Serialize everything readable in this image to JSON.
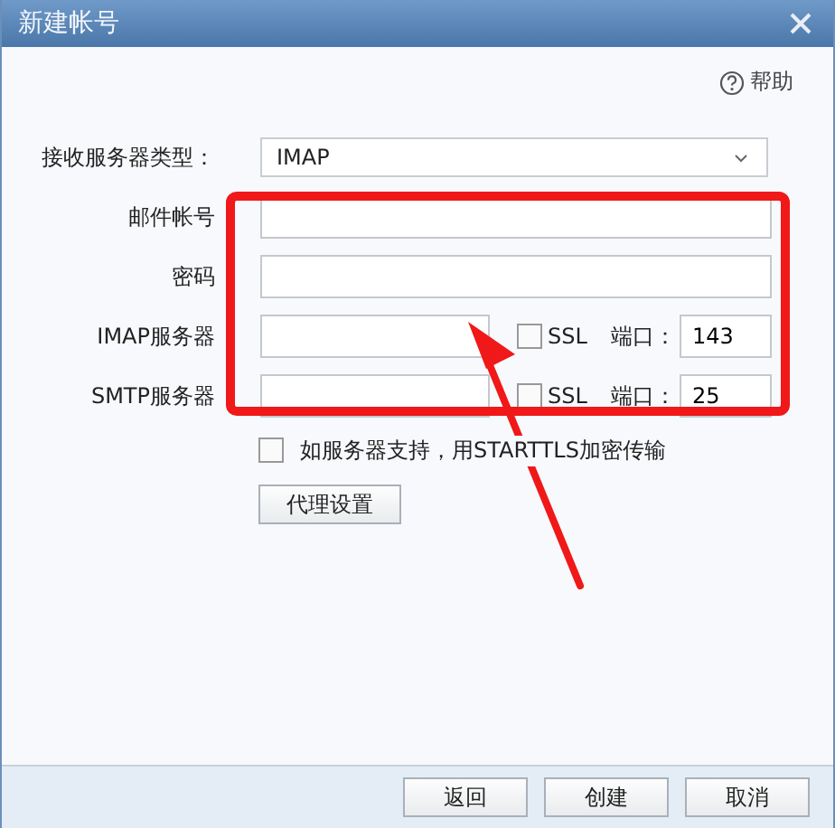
{
  "window": {
    "title": "新建帐号"
  },
  "help": {
    "label": "帮助"
  },
  "fields": [
    {
      "kind": "select",
      "label": "接收服务器类型：",
      "value": "IMAP"
    },
    {
      "kind": "text",
      "label": "邮件帐号"
    },
    {
      "kind": "text",
      "label": "密码"
    },
    {
      "kind": "server",
      "label": "IMAP服务器",
      "ssl_label": "SSL",
      "ssl_checked": false,
      "port_label": "端口：",
      "port": "143"
    },
    {
      "kind": "server",
      "label": "SMTP服务器",
      "ssl_label": "SSL",
      "ssl_checked": false,
      "port_label": "端口：",
      "port": "25"
    }
  ],
  "starttls": {
    "label": "如服务器支持，用STARTTLS加密传输",
    "checked": false
  },
  "proxy_button": "代理设置",
  "buttons": [
    "返回",
    "创建",
    "取消"
  ]
}
